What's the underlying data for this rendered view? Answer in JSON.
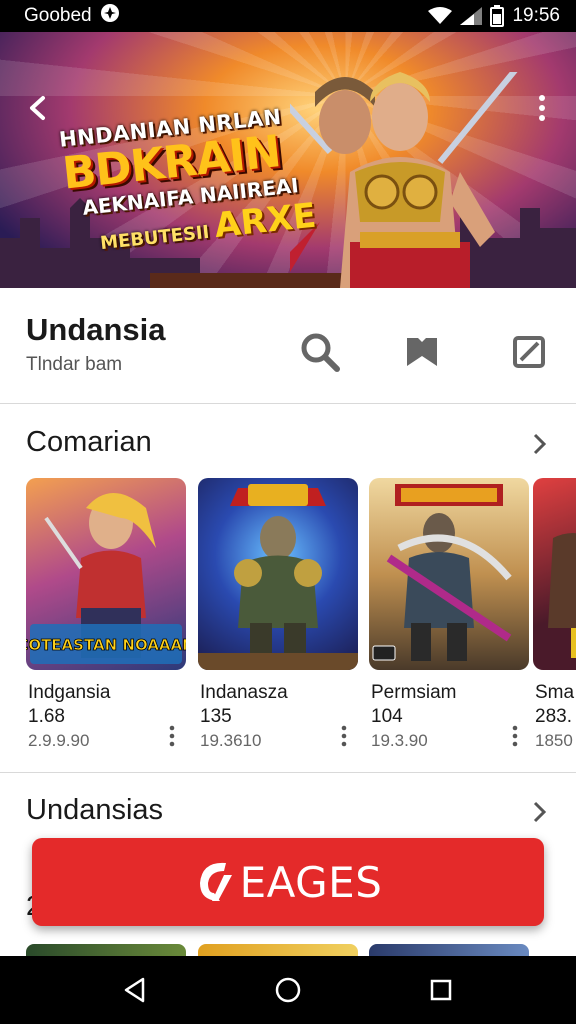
{
  "status_bar": {
    "carrier": "Goobed",
    "time": "19:56"
  },
  "hero": {
    "line1": "HNDANIAN NRLAN",
    "line2": "BDKRAIN",
    "line3": "AEKNAIFA NAIIREAI",
    "line4": "MEBUTESII",
    "line5": "ARXE",
    "back_icon": "back-arrow-icon",
    "menu_icon": "more-vert-icon"
  },
  "app": {
    "title": "Undansia",
    "subtitle": "Tlndar bam",
    "icons": [
      "search-icon",
      "bookmark-icon",
      "edit-icon"
    ]
  },
  "section1": {
    "title": "Comarian",
    "cards": [
      {
        "name": "Indgansia",
        "rating": "1.68",
        "meta": "2.9.9.90",
        "art_text": "COTEASTAN NOAAAN"
      },
      {
        "name": "Indanasza",
        "rating": "135",
        "meta": "19.3610"
      },
      {
        "name": "Permsiam",
        "rating": "104",
        "meta": "19.3.90"
      },
      {
        "name": "Sma",
        "rating": "283.",
        "meta": "1850"
      }
    ]
  },
  "section2": {
    "title": "Undansias",
    "peek_initial": "2"
  },
  "cta": {
    "label": "EAGES",
    "color": "#e42a2a"
  },
  "nav": {
    "icons": [
      "back-triangle-icon",
      "home-circle-icon",
      "recents-square-icon"
    ]
  }
}
